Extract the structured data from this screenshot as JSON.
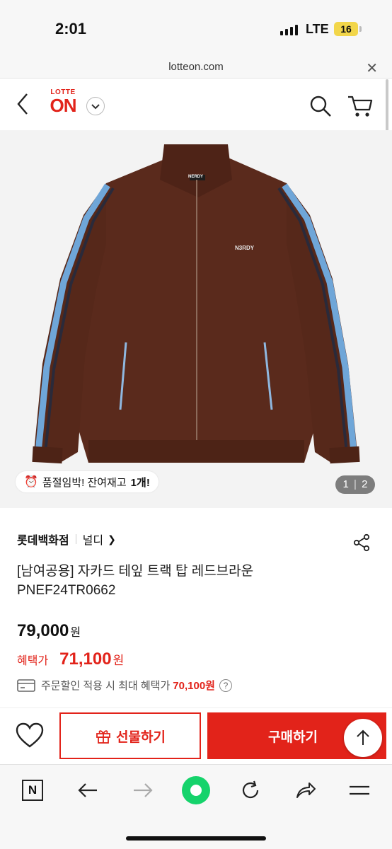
{
  "status_bar": {
    "time": "2:01",
    "network": "LTE",
    "battery": "16"
  },
  "url_bar": {
    "url": "lotteon.com",
    "close_icon": "close-icon"
  },
  "header": {
    "logo_top": "LOTTE",
    "logo_main": "ON",
    "icons": [
      "back-icon",
      "chevron-down-icon",
      "search-icon",
      "cart-icon"
    ]
  },
  "product_image": {
    "stock_alert": {
      "prefix": "품절임박! 잔여재고",
      "count": "1개!"
    },
    "counter": {
      "current": "1",
      "total": "2"
    },
    "chest_logo": "N3RDY",
    "neck_label": "NERDY"
  },
  "product": {
    "store": "롯데백화점",
    "brand": "널디",
    "title": "[남여공용] 자카드 테잎 트랙 탑 레드브라운 PNEF24TR0662",
    "price": "79,000",
    "price_unit": "원",
    "benefit_label": "혜택가",
    "benefit_price": "71,100",
    "benefit_unit": "원",
    "coupon_text": "주문할인 적용 시 최대 혜택가",
    "coupon_price": "70,100원",
    "help": "?"
  },
  "purchase_bar": {
    "gift_label": "선물하기",
    "buy_label": "구매하기"
  },
  "browser_toolbar": {
    "n_label": "N",
    "icons": [
      "n-icon",
      "back-arrow-icon",
      "forward-arrow-icon",
      "green-home-icon",
      "refresh-icon",
      "share-arrow-icon",
      "menu-icon"
    ]
  },
  "colors": {
    "brand_red": "#e2231a",
    "jacket_brown": "#5a2a1c",
    "stripe_blue": "#6fa6d8",
    "green": "#15d36b"
  }
}
